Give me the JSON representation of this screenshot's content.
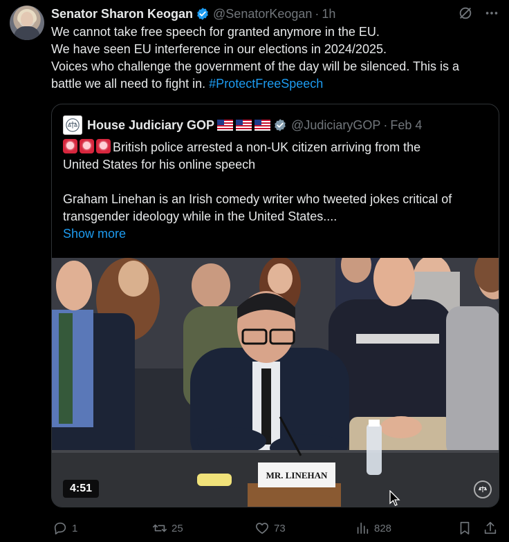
{
  "author": {
    "name": "Senator Sharon Keogan",
    "handle": "@SenatorKeogan",
    "separator": "·",
    "time": "1h"
  },
  "tweet": {
    "lines": [
      "We cannot take free speech for granted anymore in the EU.",
      "We have seen EU interference in our elections in 2024/2025.",
      "Voices who challenge the government of the day will be silenced. This is a"
    ],
    "last_line_text": "battle we all need to fight in.",
    "hashtag": "#ProtectFreeSpeech"
  },
  "quote": {
    "name": "House Judiciary GOP",
    "handle": "@JudiciaryGOP",
    "separator": "·",
    "date": "Feb 4",
    "line1": "British police arrested a non-UK citizen arriving from the",
    "line2": "United States for his online speech",
    "line3": "Graham Linehan is an Irish comedy writer who tweeted jokes critical of",
    "line4": "transgender ideology while in the United States....",
    "show_more": "Show more",
    "video": {
      "duration": "4:51",
      "nameplate": "MR. LINEHAN"
    }
  },
  "actions": {
    "replies": "1",
    "reposts": "25",
    "likes": "73",
    "views": "828"
  },
  "colors": {
    "background": "#000000",
    "text": "#e7e9ea",
    "secondary": "#71767b",
    "link": "#1d9bf0",
    "verified": "#1d9bf0",
    "border": "#2f3336"
  },
  "icons": [
    "verified-badge-icon",
    "grok-icon",
    "more-icon",
    "reply-icon",
    "repost-icon",
    "like-icon",
    "views-icon",
    "bookmark-icon",
    "share-icon",
    "siren-icon",
    "flag-icon"
  ]
}
